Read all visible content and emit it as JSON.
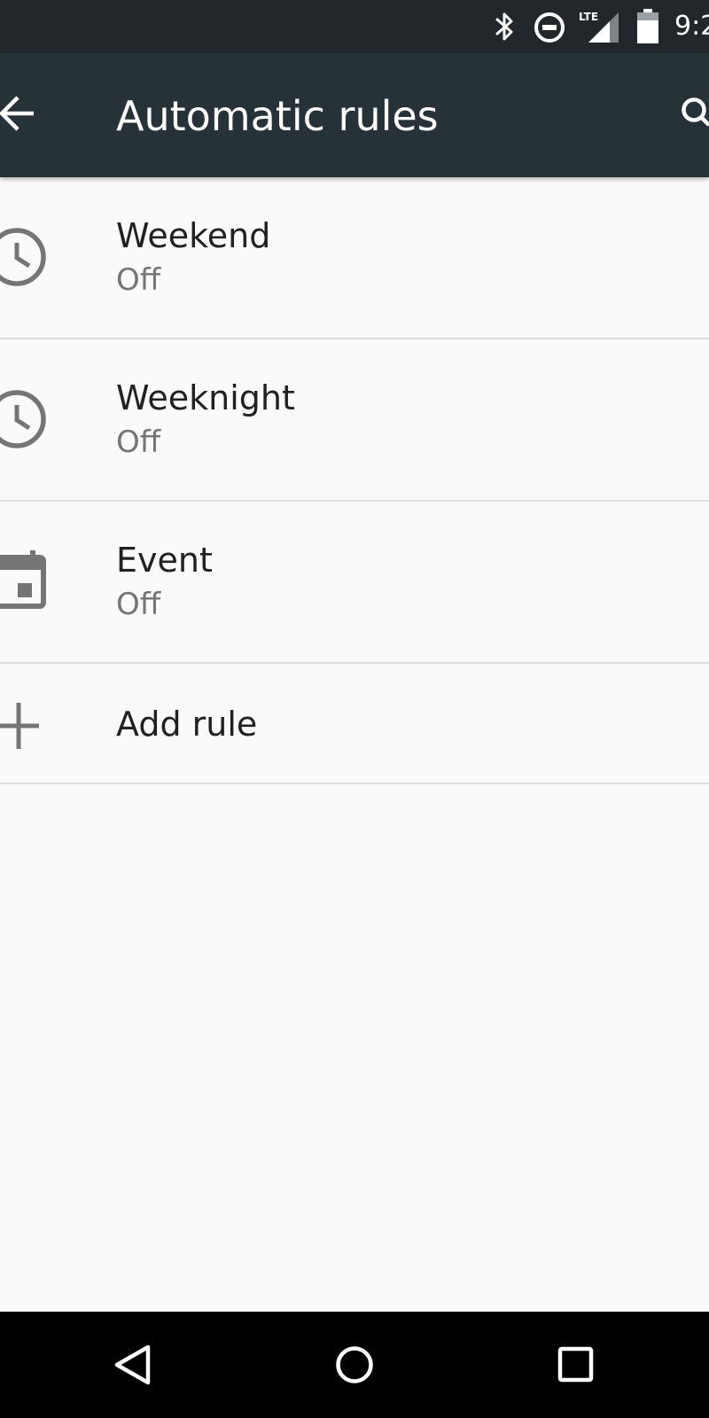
{
  "status_bar": {
    "time": "9:2",
    "icons": [
      "bluetooth-icon",
      "do-not-disturb-icon",
      "lte-signal-icon",
      "battery-icon"
    ],
    "network_label": "LTE"
  },
  "app_bar": {
    "title": "Automatic rules",
    "back_icon": "arrow-back-icon",
    "search_icon": "search-icon"
  },
  "rules": [
    {
      "name": "Weekend",
      "status": "Off",
      "icon": "clock-icon"
    },
    {
      "name": "Weeknight",
      "status": "Off",
      "icon": "clock-icon"
    },
    {
      "name": "Event",
      "status": "Off",
      "icon": "calendar-icon"
    }
  ],
  "add_rule": {
    "label": "Add rule",
    "icon": "plus-icon"
  },
  "nav_bar": {
    "buttons": [
      "back-triangle-icon",
      "home-circle-icon",
      "recents-square-icon"
    ]
  },
  "colors": {
    "status_bar_bg": "#21272b",
    "app_bar_bg": "#263238",
    "page_bg": "#fafafa",
    "primary_text": "#212121",
    "secondary_text": "#757575",
    "icon_gray": "#757575",
    "divider": "#dedede",
    "nav_bar_bg": "#000000"
  }
}
